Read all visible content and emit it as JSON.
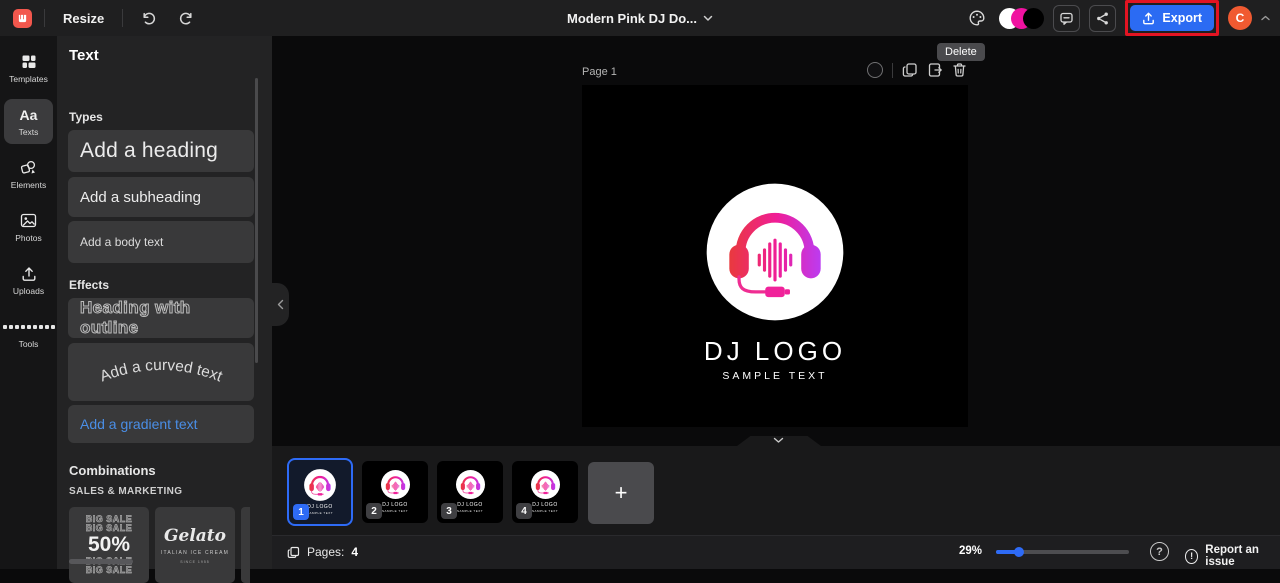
{
  "topbar": {
    "resize_label": "Resize",
    "doc_title": "Modern Pink DJ Do...",
    "export_label": "Export",
    "avatar_initial": "C",
    "brand_color": "#f2574d",
    "accent_blue": "#2b6bf3",
    "annotation_red": "#e31422",
    "palette_colors": [
      "#ffffff",
      "#f012a0",
      "#000000"
    ]
  },
  "sidebar": {
    "items": [
      {
        "label": "Templates"
      },
      {
        "label": "Texts",
        "icon_glyph": "Aa"
      },
      {
        "label": "Elements"
      },
      {
        "label": "Photos"
      },
      {
        "label": "Uploads"
      },
      {
        "label": "Tools"
      }
    ],
    "active_item": "Texts"
  },
  "panel": {
    "title": "Text",
    "types": {
      "heading": "Types",
      "items": [
        "Add a heading",
        "Add a subheading",
        "Add a body text"
      ]
    },
    "effects": {
      "heading": "Effects",
      "items": [
        "Heading with outline",
        "Add a curved text",
        "Add a gradient text"
      ]
    },
    "combinations": {
      "heading": "Combinations",
      "category": "SALES & MARKETING",
      "cards": [
        {
          "name": "big-sale",
          "lines": [
            "BIG SALE",
            "BIG SALE",
            "50%",
            "BIG SALE",
            "BIG SALE"
          ]
        },
        {
          "name": "gelato",
          "title": "Gelato",
          "subtitle": "ITALIAN ICE CREAM",
          "tagline": "SINCE 1955"
        }
      ]
    }
  },
  "canvas": {
    "page_label": "Page 1",
    "tooltip": "Delete",
    "logo_title": "DJ LOGO",
    "logo_subtitle": "SAMPLE TEXT",
    "logo_gradient": [
      "#e93a3c",
      "#f01d97",
      "#bb3cf2"
    ]
  },
  "pages": {
    "thumbnails": [
      {
        "number": "1",
        "selected": true
      },
      {
        "number": "2",
        "selected": false
      },
      {
        "number": "3",
        "selected": false
      },
      {
        "number": "4",
        "selected": false
      }
    ],
    "add_label": "+"
  },
  "statusbar": {
    "pages_label": "Pages:",
    "pages_count": "4",
    "zoom_value": "29%",
    "help_glyph": "?",
    "report_glyph": "!",
    "report_label": "Report an issue"
  }
}
